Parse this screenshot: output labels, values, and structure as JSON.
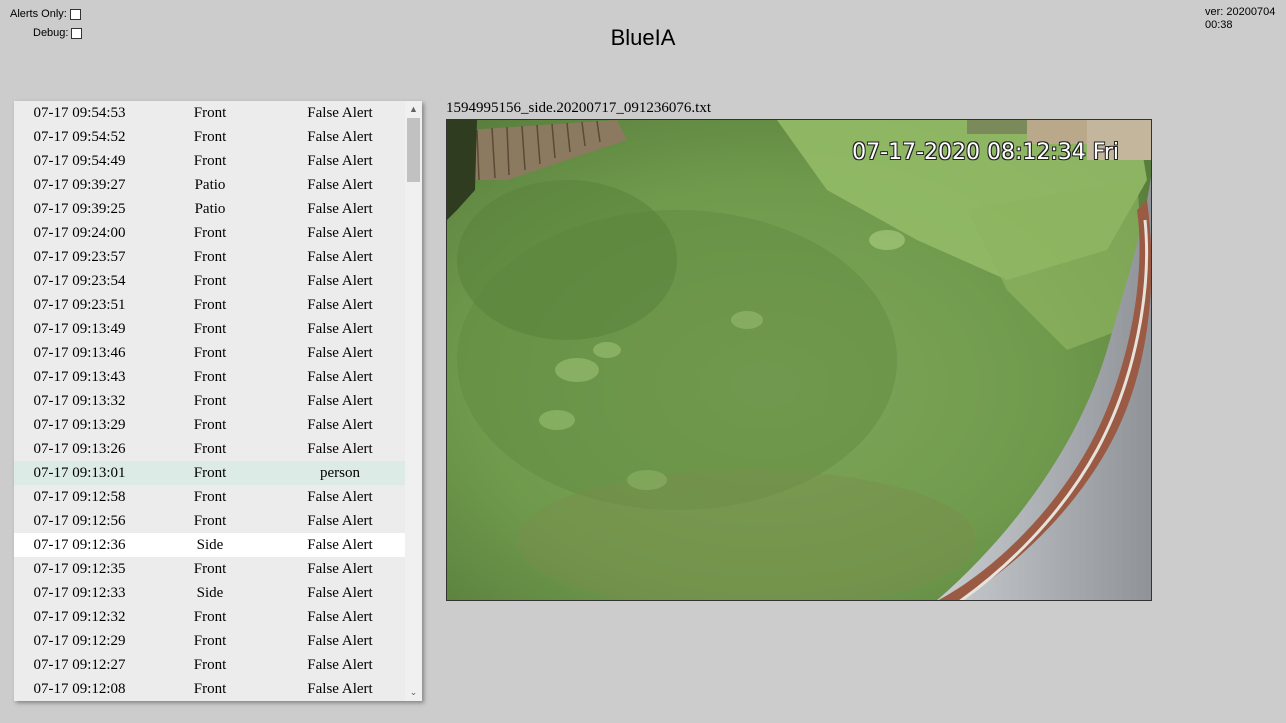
{
  "header": {
    "title": "BlueIA",
    "version_line1": "ver: 20200704",
    "version_line2": "00:38",
    "alerts_only_label": "Alerts Only:",
    "debug_label": "Debug:"
  },
  "viewer": {
    "file_name": "1594995156_side.20200717_091236076.txt",
    "camera_timestamp": "07-17-2020 08:12:34 Fri"
  },
  "list": {
    "scroll_up_icon": "▲",
    "scroll_down_icon": "⌄",
    "rows": [
      {
        "time": "07-17 09:54:53",
        "camera": "Front",
        "result": "False Alert",
        "state": ""
      },
      {
        "time": "07-17 09:54:52",
        "camera": "Front",
        "result": "False Alert",
        "state": ""
      },
      {
        "time": "07-17 09:54:49",
        "camera": "Front",
        "result": "False Alert",
        "state": ""
      },
      {
        "time": "07-17 09:39:27",
        "camera": "Patio",
        "result": "False Alert",
        "state": ""
      },
      {
        "time": "07-17 09:39:25",
        "camera": "Patio",
        "result": "False Alert",
        "state": ""
      },
      {
        "time": "07-17 09:24:00",
        "camera": "Front",
        "result": "False Alert",
        "state": ""
      },
      {
        "time": "07-17 09:23:57",
        "camera": "Front",
        "result": "False Alert",
        "state": ""
      },
      {
        "time": "07-17 09:23:54",
        "camera": "Front",
        "result": "False Alert",
        "state": ""
      },
      {
        "time": "07-17 09:23:51",
        "camera": "Front",
        "result": "False Alert",
        "state": ""
      },
      {
        "time": "07-17 09:13:49",
        "camera": "Front",
        "result": "False Alert",
        "state": ""
      },
      {
        "time": "07-17 09:13:46",
        "camera": "Front",
        "result": "False Alert",
        "state": ""
      },
      {
        "time": "07-17 09:13:43",
        "camera": "Front",
        "result": "False Alert",
        "state": ""
      },
      {
        "time": "07-17 09:13:32",
        "camera": "Front",
        "result": "False Alert",
        "state": ""
      },
      {
        "time": "07-17 09:13:29",
        "camera": "Front",
        "result": "False Alert",
        "state": ""
      },
      {
        "time": "07-17 09:13:26",
        "camera": "Front",
        "result": "False Alert",
        "state": ""
      },
      {
        "time": "07-17 09:13:01",
        "camera": "Front",
        "result": "person",
        "state": "alert"
      },
      {
        "time": "07-17 09:12:58",
        "camera": "Front",
        "result": "False Alert",
        "state": ""
      },
      {
        "time": "07-17 09:12:56",
        "camera": "Front",
        "result": "False Alert",
        "state": ""
      },
      {
        "time": "07-17 09:12:36",
        "camera": "Side",
        "result": "False Alert",
        "state": "selected"
      },
      {
        "time": "07-17 09:12:35",
        "camera": "Front",
        "result": "False Alert",
        "state": ""
      },
      {
        "time": "07-17 09:12:33",
        "camera": "Side",
        "result": "False Alert",
        "state": ""
      },
      {
        "time": "07-17 09:12:32",
        "camera": "Front",
        "result": "False Alert",
        "state": ""
      },
      {
        "time": "07-17 09:12:29",
        "camera": "Front",
        "result": "False Alert",
        "state": ""
      },
      {
        "time": "07-17 09:12:27",
        "camera": "Front",
        "result": "False Alert",
        "state": ""
      },
      {
        "time": "07-17 09:12:08",
        "camera": "Front",
        "result": "False Alert",
        "state": ""
      }
    ]
  },
  "colors": {
    "page_bg": "#cccccc",
    "alert_row_bg": "#dcebe5",
    "selected_row_bg": "#ffffff"
  }
}
